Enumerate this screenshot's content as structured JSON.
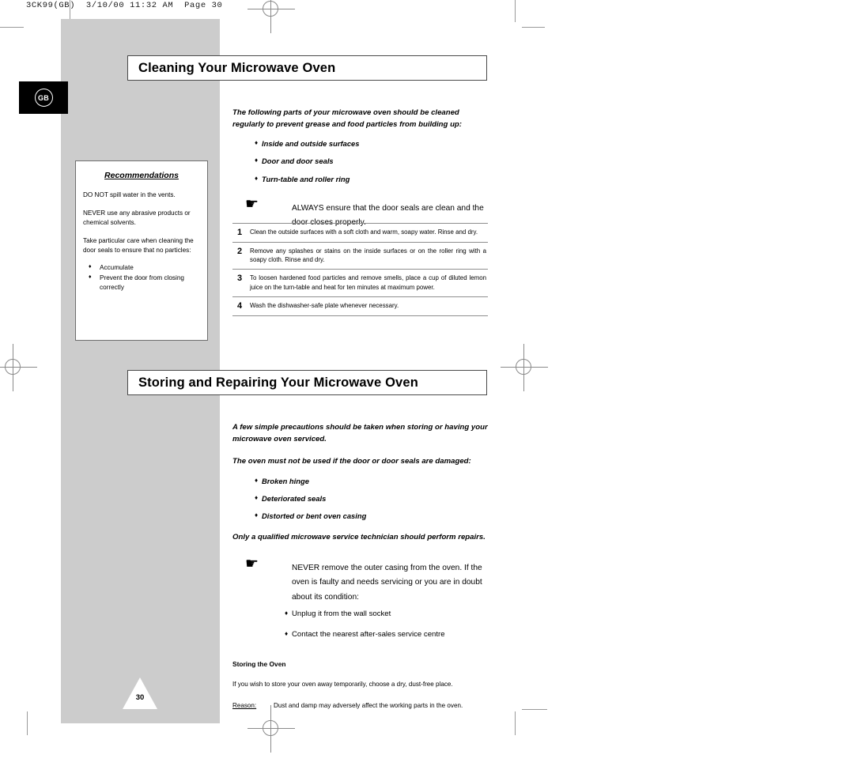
{
  "print": {
    "slug_line": "3CK99(GB)  3/10/00 11:32 AM  Page 30",
    "page_number": "30"
  },
  "language_badge": {
    "code": "GB"
  },
  "sections": [
    {
      "title": "Cleaning Your Microwave Oven",
      "lead": "The following parts of your microwave oven should be cleaned regularly to prevent grease and food particles from building up:",
      "bullets": [
        "Inside and outside surfaces",
        "Door and door seals",
        "Turn-table and roller ring"
      ],
      "note": "ALWAYS ensure that the door seals are clean and the door closes properly.",
      "steps": [
        {
          "number": "1",
          "text": "Clean the outside surfaces with a soft cloth and warm, soapy water. Rinse and dry."
        },
        {
          "number": "2",
          "text": "Remove any splashes or stains on the inside surfaces or on the roller ring with a soapy cloth. Rinse and dry."
        },
        {
          "number": "3",
          "text": "To loosen hardened food particles and remove smells, place a cup of diluted lemon juice on the turn-table and heat for ten minutes at maximum power."
        },
        {
          "number": "4",
          "text": "Wash the dishwasher-safe plate whenever necessary."
        }
      ]
    },
    {
      "title": "Storing and Repairing Your Microwave Oven",
      "lead": "A few simple precautions should be taken when storing or having your microwave oven serviced.",
      "lead2": "The oven must not be used if the door or door seals are damaged:",
      "bullets": [
        "Broken hinge",
        "Deteriorated seals",
        "Distorted or bent oven casing"
      ],
      "lead3": "Only a qualified microwave service technician should perform repairs.",
      "note": "NEVER remove the outer casing from the oven. If the oven is faulty and needs servicing or you are in doubt about its condition:",
      "plain_bullets": [
        "Unplug it from the wall socket",
        "Contact the nearest after-sales service centre"
      ],
      "sub_heading": "Storing the Oven",
      "sub_paragraph": "If you wish to store your oven away temporarily, choose a dry, dust-free place.",
      "reason_label": "Reason:",
      "reason_text": "Dust and damp may adversely affect the working parts in the oven."
    }
  ],
  "recommendations": {
    "heading": "Recommendations",
    "paragraphs": [
      "DO NOT spill water in the vents.",
      "NEVER use any abrasive products or chemical solvents.",
      "Take particular care when cleaning the door seals to ensure that no particles:"
    ],
    "bullets": [
      "Accumulate",
      "Prevent the door from closing correctly"
    ]
  },
  "glyphs": {
    "diamond": "♦",
    "hand": "☛"
  }
}
